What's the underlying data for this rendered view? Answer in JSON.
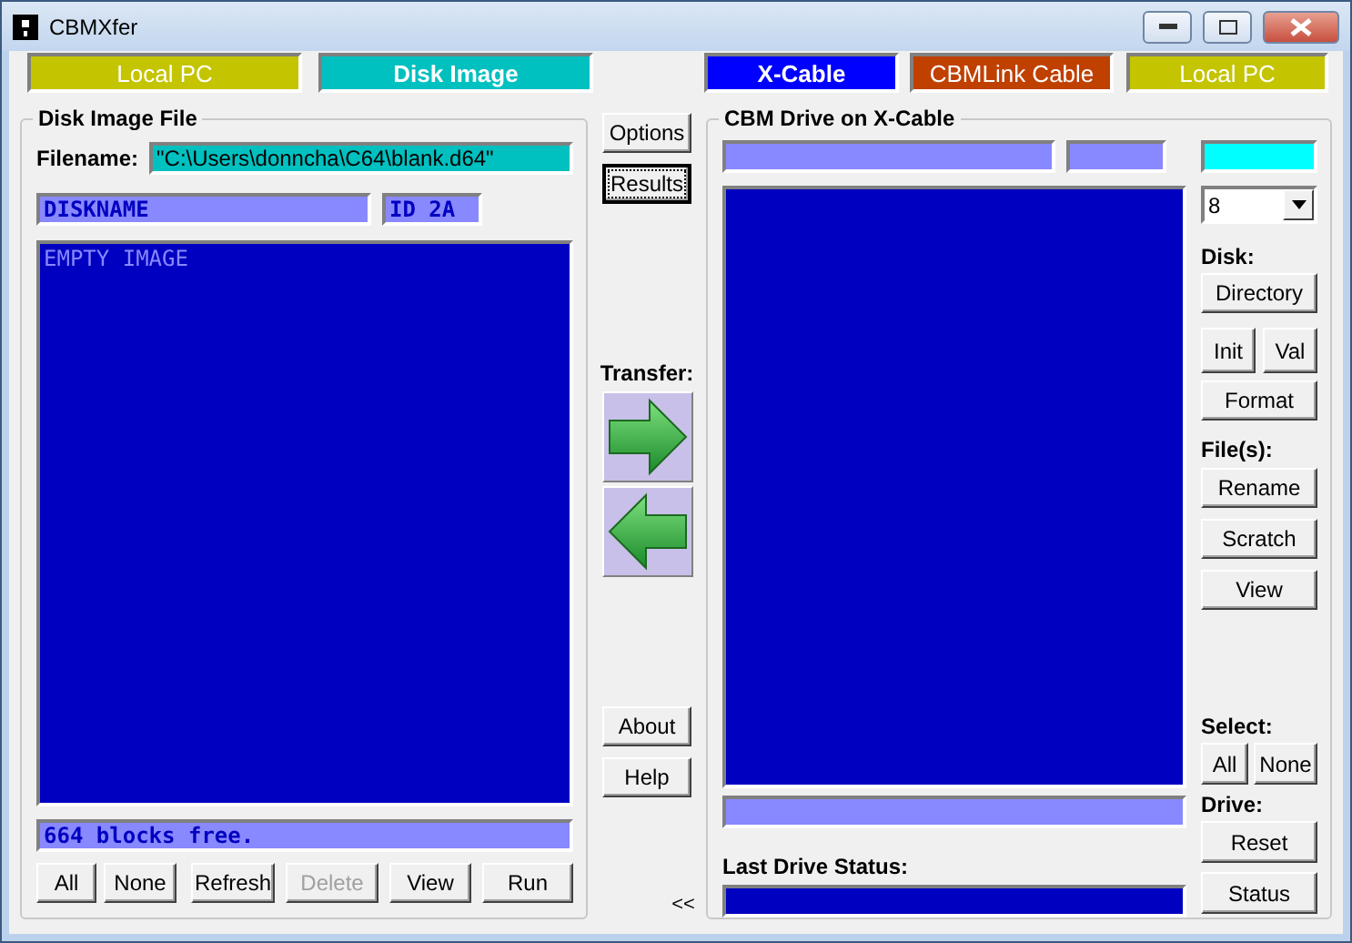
{
  "window": {
    "title": "CBMXfer"
  },
  "mode_bars_left": [
    {
      "label": "Local PC",
      "color": "#c4c400",
      "selected": false
    },
    {
      "label": "Disk Image",
      "color": "#00c0c0",
      "selected": true
    }
  ],
  "mode_bars_right": [
    {
      "label": "X-Cable",
      "color": "#0000ff",
      "selected": true
    },
    {
      "label": "CBMLink Cable",
      "color": "#c04000",
      "selected": false
    },
    {
      "label": "Local PC",
      "color": "#c4c400",
      "selected": false
    }
  ],
  "disk_image": {
    "title": "Disk Image File",
    "filename_label": "Filename:",
    "filename": "\"C:\\Users\\donncha\\C64\\blank.d64\"",
    "disk_name": "DISKNAME",
    "disk_id": "ID 2A",
    "listing": [
      "EMPTY IMAGE"
    ],
    "blocks_free": "664 blocks free.",
    "buttons": [
      {
        "label": "All",
        "disabled": false
      },
      {
        "label": "None",
        "disabled": false
      },
      {
        "label": "Refresh",
        "disabled": false
      },
      {
        "label": "Delete",
        "disabled": true
      },
      {
        "label": "View",
        "disabled": false
      },
      {
        "label": "Run",
        "disabled": false
      }
    ]
  },
  "middle": {
    "top_buttons": [
      {
        "label": "Options",
        "focused": false
      },
      {
        "label": "Results",
        "focused": true
      }
    ],
    "transfer_label": "Transfer:",
    "bottom_buttons": [
      "About",
      "Help"
    ],
    "collapse": "<<"
  },
  "drive": {
    "title": "CBM Drive on X-Cable",
    "drive_number": "8",
    "disk_label": "Disk:",
    "directory": "Directory",
    "init": "Init",
    "validate": "Val",
    "format": "Format",
    "files_label": "File(s):",
    "file_buttons": [
      "Rename",
      "Scratch",
      "View"
    ],
    "select_label": "Select:",
    "select_buttons": [
      "All",
      "None"
    ],
    "drive_label": "Drive:",
    "drive_buttons": [
      "Reset",
      "Status"
    ],
    "last_status_label": "Last Drive Status:"
  }
}
